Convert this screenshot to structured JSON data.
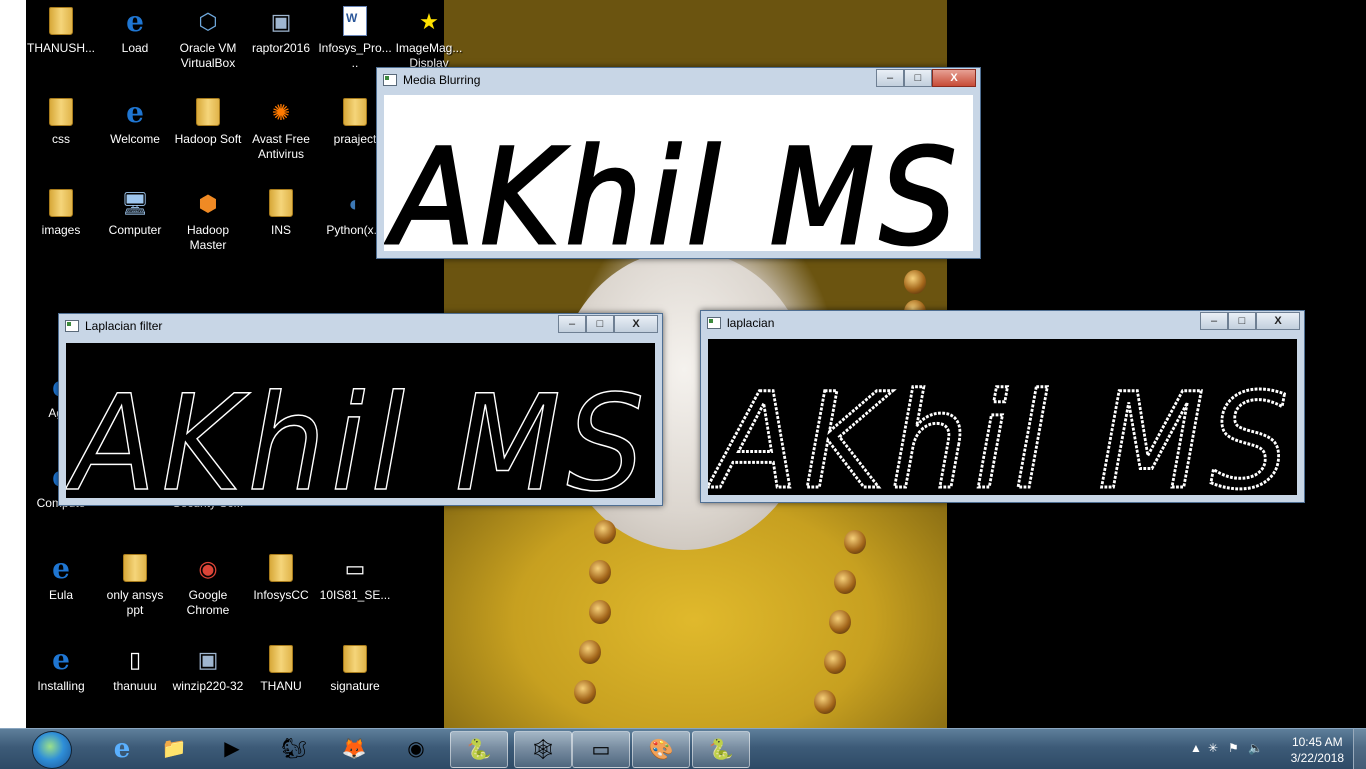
{
  "desktop": {
    "icons": [
      {
        "label": "THANUSH...",
        "icon": "user-folder-icon"
      },
      {
        "label": "Load",
        "icon": "internet-explorer-icon"
      },
      {
        "label": "Oracle VM\nVirtualBox",
        "icon": "virtualbox-icon"
      },
      {
        "label": "raptor2016",
        "icon": "installer-icon"
      },
      {
        "label": "Infosys_Pro...\n..",
        "icon": "word-document-icon"
      },
      {
        "label": "ImageMag...\nDisplay",
        "icon": "shortcut-star-icon"
      },
      {
        "label": "css",
        "icon": "folder-icon"
      },
      {
        "label": "Welcome",
        "icon": "internet-explorer-icon"
      },
      {
        "label": "Hadoop Soft",
        "icon": "folder-icon"
      },
      {
        "label": "Avast Free\nAntivirus",
        "icon": "avast-icon"
      },
      {
        "label": "praaject",
        "icon": "folder-icon"
      },
      {
        "label": "images",
        "icon": "folder-icon"
      },
      {
        "label": "Computer",
        "icon": "computer-icon"
      },
      {
        "label": "Hadoop\nMaster",
        "icon": "virtualbox-cube-icon"
      },
      {
        "label": "INS",
        "icon": "folder-icon"
      },
      {
        "label": "Python(x...",
        "icon": "python-shortcut-icon"
      },
      {
        "label": "Agre",
        "icon": "internet-explorer-icon"
      },
      {
        "label": "Compute",
        "icon": "internet-explorer-icon"
      },
      {
        "label": "Security Sc...",
        "icon": "shield-icon"
      },
      {
        "label": "Eula",
        "icon": "internet-explorer-icon"
      },
      {
        "label": "only ansys\nppt",
        "icon": "folder-icon"
      },
      {
        "label": "Google\nChrome",
        "icon": "chrome-icon"
      },
      {
        "label": "InfosysCC",
        "icon": "folder-icon"
      },
      {
        "label": "10IS81_SE...",
        "icon": "image-file-icon"
      },
      {
        "label": "Installing",
        "icon": "internet-explorer-icon"
      },
      {
        "label": "thanuuu",
        "icon": "text-file-icon"
      },
      {
        "label": "winzip220-32",
        "icon": "installer-icon"
      },
      {
        "label": "THANU",
        "icon": "folder-icon"
      },
      {
        "label": "signature",
        "icon": "folder-icon"
      }
    ]
  },
  "windows": {
    "media_blurring": {
      "title": "Media Blurring",
      "content_text": "AKhil MS",
      "content_style": "black-ink-on-white"
    },
    "laplacian_filter": {
      "title": "Laplacian filter",
      "content_text": "AKhil MS",
      "content_style": "thin-white-outline-on-black"
    },
    "laplacian": {
      "title": "laplacian",
      "content_text": "AKhil MS",
      "content_style": "noisy-white-edges-on-black"
    },
    "controls": {
      "minimize": "–",
      "maximize": "□",
      "close": "X"
    }
  },
  "taskbar": {
    "pinned": [
      {
        "name": "internet-explorer",
        "glyph": "e"
      },
      {
        "name": "file-explorer",
        "glyph": "📁"
      },
      {
        "name": "media-player",
        "glyph": "▶"
      },
      {
        "name": "uc-browser",
        "glyph": "🐿"
      },
      {
        "name": "firefox",
        "glyph": "🦊"
      },
      {
        "name": "chrome",
        "glyph": "◉"
      },
      {
        "name": "python-idle",
        "glyph": "🐍"
      },
      {
        "name": "raptor",
        "glyph": "🕸"
      },
      {
        "name": "powerpoint",
        "glyph": "▭"
      },
      {
        "name": "paint",
        "glyph": "🎨"
      },
      {
        "name": "python-window",
        "glyph": "🐍"
      }
    ],
    "clock": {
      "time": "10:45 AM",
      "date": "3/22/2018"
    }
  },
  "colors": {
    "taskbar": "#3d5b78",
    "window_frame": "#c8d6e6",
    "close_button": "#c74b36"
  }
}
